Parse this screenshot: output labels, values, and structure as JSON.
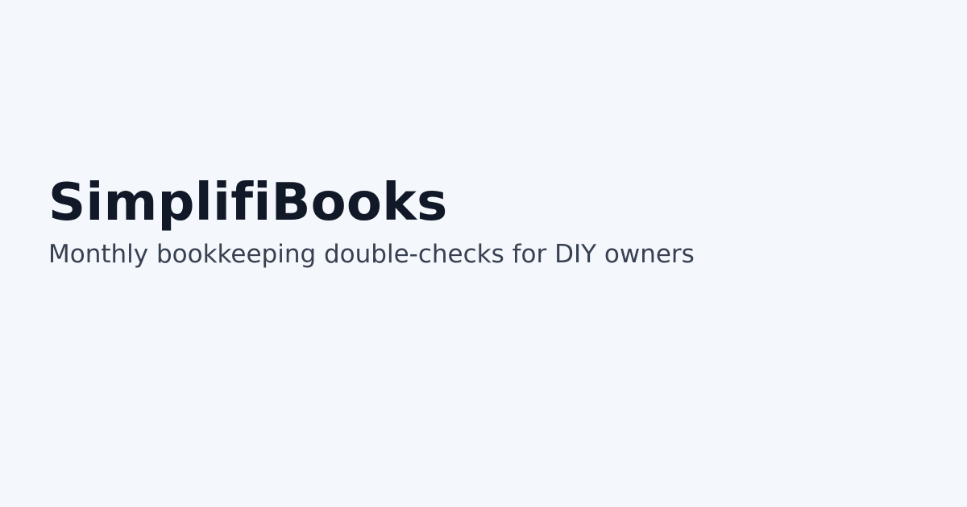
{
  "brand": {
    "name": "SimplifiBooks",
    "tagline": "Monthly bookkeeping double-checks for DIY owners"
  },
  "colors": {
    "background": "#f4f7fb",
    "title": "#111827",
    "tagline": "#374151"
  }
}
